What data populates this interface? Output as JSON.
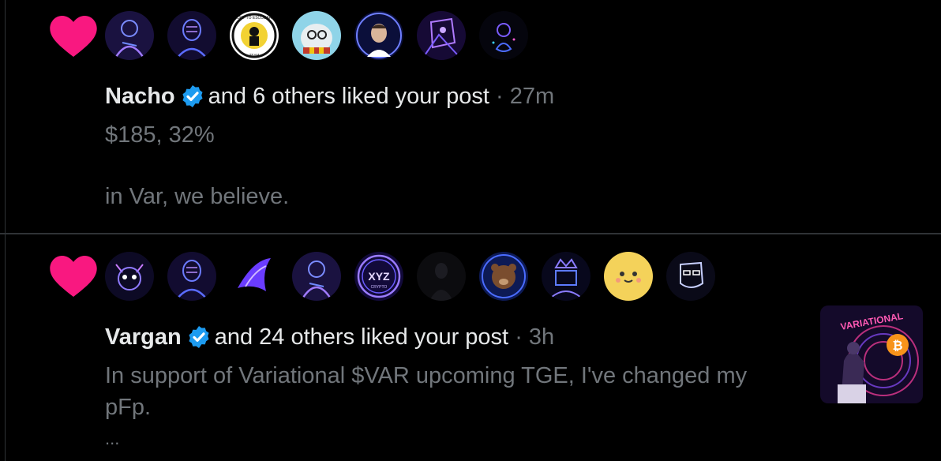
{
  "notifications": [
    {
      "name": "Nacho",
      "action": "and 6 others liked your post",
      "separator": "·",
      "time": "27m",
      "text_line1": "$185, 32%",
      "text_line2": "in Var, we believe.",
      "avatar_badge_text_top": "CRIPTO ESCOBAR",
      "avatar_badge_text_bottom": "TEAM"
    },
    {
      "name": "Vargan",
      "action": "and 24 others liked your post",
      "separator": "·",
      "time": "3h",
      "text_line1": "In support of Variational $VAR upcoming TGE, I've changed my",
      "text_line2": "pFp.",
      "ellipsis": "...",
      "avatar_xyz_text": "XYZ",
      "avatar_xyz_sub": "CRYPTO",
      "thumbnail_text": "VARIATIONAL"
    }
  ],
  "colors": {
    "heart": "#f91880",
    "verified": "#1d9bf0",
    "muted_text": "#71767b",
    "divider": "#2f3336"
  },
  "icons": [
    "heart-icon",
    "verified-badge-icon"
  ]
}
